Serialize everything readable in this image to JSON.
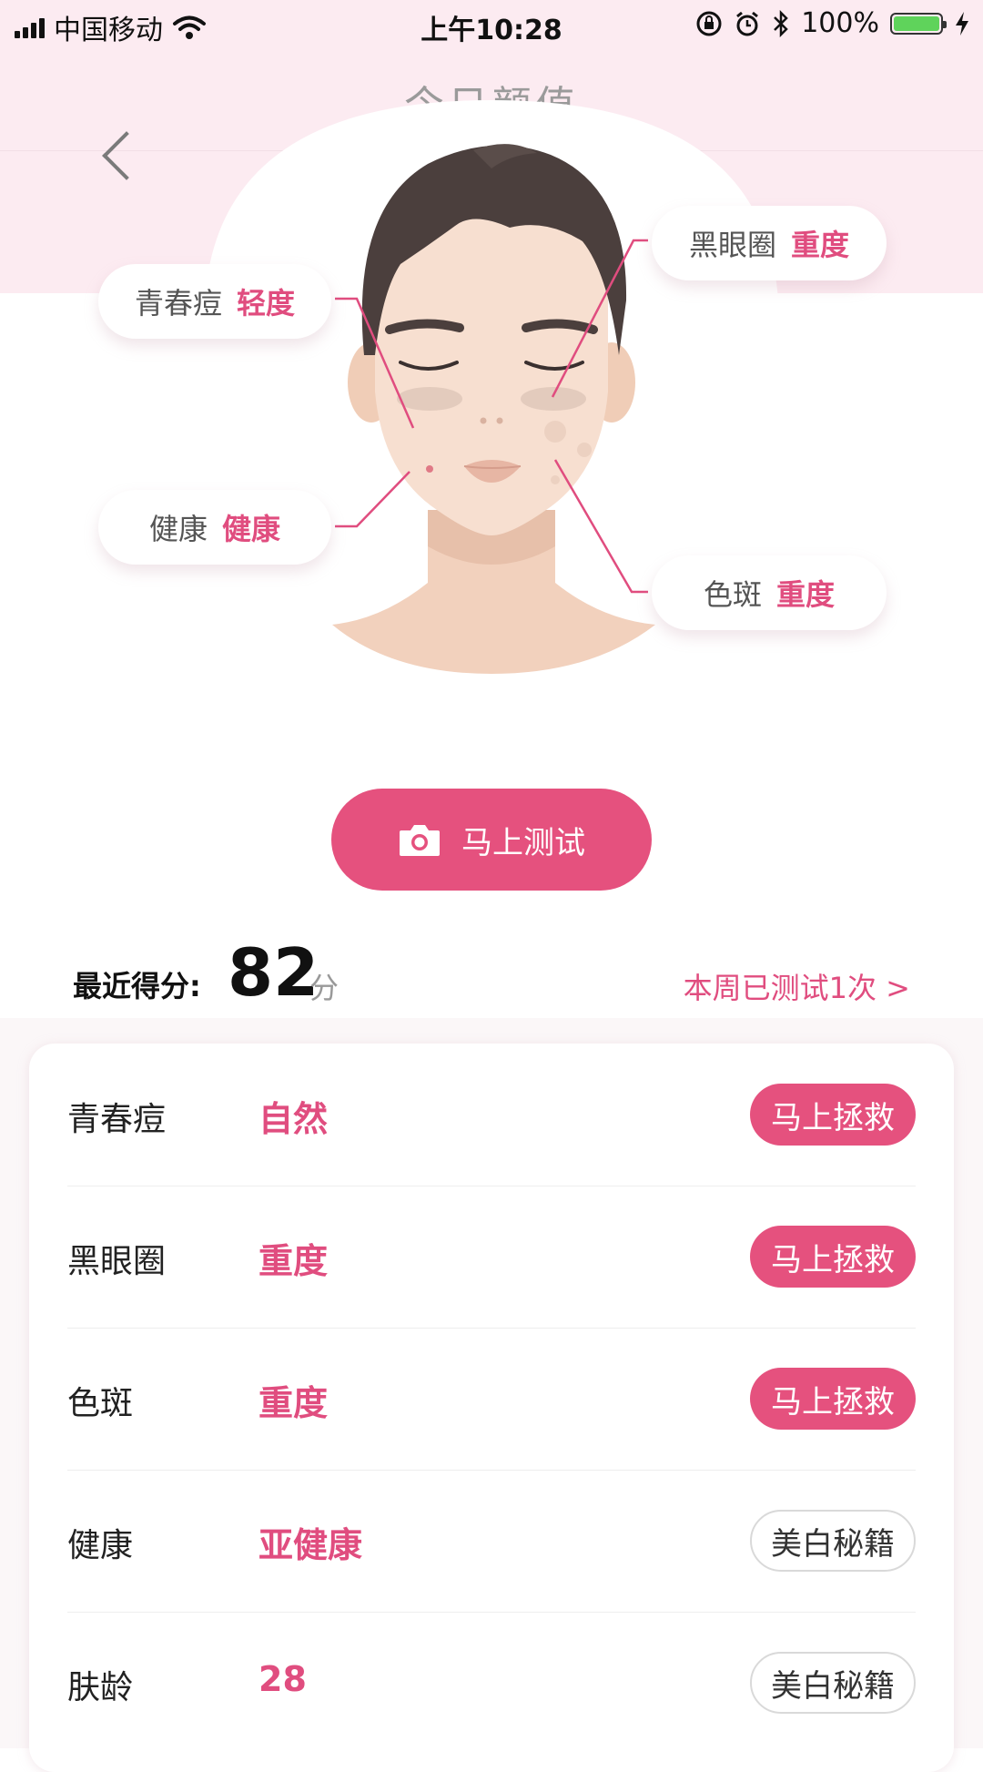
{
  "status_bar": {
    "carrier": "中国移动",
    "time": "上午10:28",
    "battery": "100%",
    "battery_level": 1.0
  },
  "nav": {
    "title": "今日颜值"
  },
  "callouts": [
    {
      "label": "青春痘",
      "severity": "轻度"
    },
    {
      "label": "黑眼圈",
      "severity": "重度"
    },
    {
      "label": "健康",
      "severity": "健康"
    },
    {
      "label": "色斑",
      "severity": "重度"
    }
  ],
  "test_button": {
    "label": "马上测试",
    "icon": "camera-icon"
  },
  "score": {
    "label": "最近得分:",
    "value": "82",
    "unit": "分",
    "week_link": "本周已测试1次 >"
  },
  "results": [
    {
      "name": "青春痘",
      "status": "自然",
      "action": "马上拯救",
      "action_style": "primary"
    },
    {
      "name": "黑眼圈",
      "status": "重度",
      "action": "马上拯救",
      "action_style": "primary"
    },
    {
      "name": "色斑",
      "status": "重度",
      "action": "马上拯救",
      "action_style": "primary"
    },
    {
      "name": "健康",
      "status": "亚健康",
      "action": "美白秘籍",
      "action_style": "outline"
    },
    {
      "name": "肤龄",
      "status": "28",
      "action": "美白秘籍",
      "action_style": "outline"
    }
  ],
  "colors": {
    "accent": "#e5517e",
    "accent_text": "#e04d7f",
    "header_bg": "#fcebf1",
    "skin": "#f6dfcf",
    "hair": "#4b3f3d"
  }
}
